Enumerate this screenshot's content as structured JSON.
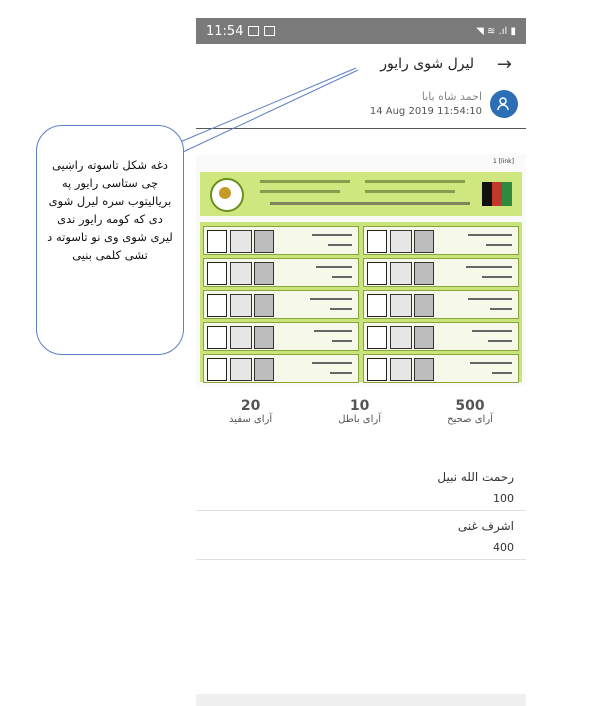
{
  "status_bar": {
    "time": "11:54",
    "icons_right": "◥ ≋ .ıl ▮"
  },
  "header": {
    "back_icon": "arrow-right-icon",
    "title": "لیرل شوی رایور"
  },
  "post": {
    "author": "احمد شاه بابا",
    "timestamp": "14 Aug 2019 11:54:10",
    "avatar_icon": "user-icon"
  },
  "ballot": {
    "top_link": "1 [link]"
  },
  "stats": [
    {
      "value": "20",
      "label": "آرای سفید"
    },
    {
      "value": "10",
      "label": "آرای باطل"
    },
    {
      "value": "500",
      "label": "آرای صحیح"
    }
  ],
  "candidates": [
    {
      "name": "رحمت الله نبیل",
      "votes": "100"
    },
    {
      "name": "اشرف غنی",
      "votes": "400"
    }
  ],
  "callout": {
    "text": "دغه شکل تاسوته راښیی چی ستاسی رایور په بریالیتوب سره لیرل شوی دی که کومه رایور ندی لیری شوی وی نو تاسوته د تشی کلمی بنیی"
  },
  "colors": {
    "accent": "#2c6fb7",
    "status_bar": "#7a7a7a",
    "ballot_green": "#c9e47a"
  }
}
